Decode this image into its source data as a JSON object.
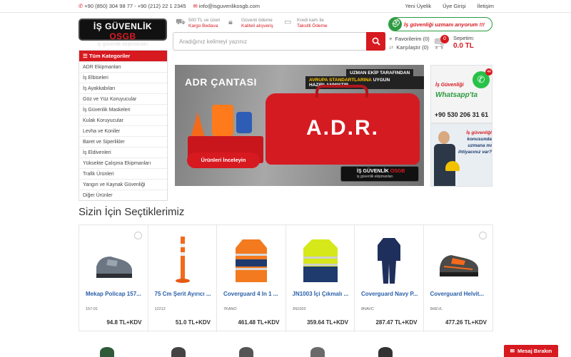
{
  "topbar": {
    "phones": "+90 (850) 304 98 77 - +90 (212) 22 1 2345",
    "email": "info@isguvenlikosgb.com",
    "links": [
      "Yeni Üyelik",
      "Üye Girişi",
      "İletişim"
    ]
  },
  "logo": {
    "line1_a": "İŞ GÜVENLİK",
    "line1_b": "OSGB",
    "line2": "iş güvenlik ekipmanları"
  },
  "features": [
    {
      "line1": "500 TL ve üzeri",
      "line2": "Kargo Bedava"
    },
    {
      "line1": "Güvenli ödeme",
      "line2": "Kaliteli alışveriş"
    },
    {
      "line1": "Kredi kartı ile",
      "line2": "Taksitli Ödeme"
    }
  ],
  "safety_badge": "İş güvenliği uzmanı arıyorum !!!",
  "search": {
    "placeholder": "Aradığınız kelimeyi yazınız"
  },
  "favorites": "Favorilerim (0)",
  "compare": "Karşılaştır (0)",
  "cart": {
    "count": "0",
    "label": "Sepetim:",
    "total": "0.0 TL"
  },
  "categories": {
    "header": "Tüm Kategoriler",
    "items": [
      "ADR Ekipmanları",
      "İş Elbiseleri",
      "İş Ayakkabıları",
      "Göz ve Yüz Koruyucular",
      "İş Güvenlik Maskeleri",
      "Kulak Koruyucular",
      "Levha ve Koniler",
      "Baret ve Siperlikler",
      "İş Eldivenleri",
      "Yüksekte Çalışma Ekipmanları",
      "Trafik Ürünleri",
      "Yangın ve Kaynak Güvenliği",
      "Diğer Ürünler"
    ]
  },
  "banner": {
    "title": "ADR ÇANTASI",
    "tag1": "UZMAN EKİP TARAFINDAN",
    "tag2_a": "AVRUPA STANDARTLARINA",
    "tag2_b": "UYGUN HAZIRLANMIŞTIR",
    "bag_text": "A.D.R.",
    "button": "Ürünleri İnceleyin",
    "logo_a": "İŞ GÜVENLİK",
    "logo_b": "OSGB",
    "logo_c": "iş güvenlik ekipmanları"
  },
  "whatsapp": {
    "line1": "İş Güvenliği",
    "line2": "Whatsapp'ta",
    "badge": "44",
    "phone": "+90 530 206 31 61"
  },
  "consult": {
    "q_a": "İş güvenliği",
    "q_b": "konusunda uzmana mı ihtiyacınız var?"
  },
  "section_title": "Sizin İçin Seçtiklerimiz",
  "products": [
    {
      "name": "Mekap Policap 157...",
      "code": "157-01",
      "price": "94.8 TL+KDV"
    },
    {
      "name": "75 Cm Şerit Ayırıcı ...",
      "code": "12212",
      "price": "51.0 TL+KDV"
    },
    {
      "name": "Coverguard 4 In 1 ...",
      "code": "7KANO",
      "price": "461.48 TL+KDV"
    },
    {
      "name": "JN1003 İçi Çıkmalı ...",
      "code": "JN1003",
      "price": "359.64 TL+KDV"
    },
    {
      "name": "Coverguard Navy P...",
      "code": "8NAVC",
      "price": "287.47 TL+KDV"
    },
    {
      "name": "Coverguard Helvit...",
      "code": "9HEVL",
      "price": "477.26 TL+KDV"
    }
  ],
  "message_button": "Mesaj Bırakın"
}
